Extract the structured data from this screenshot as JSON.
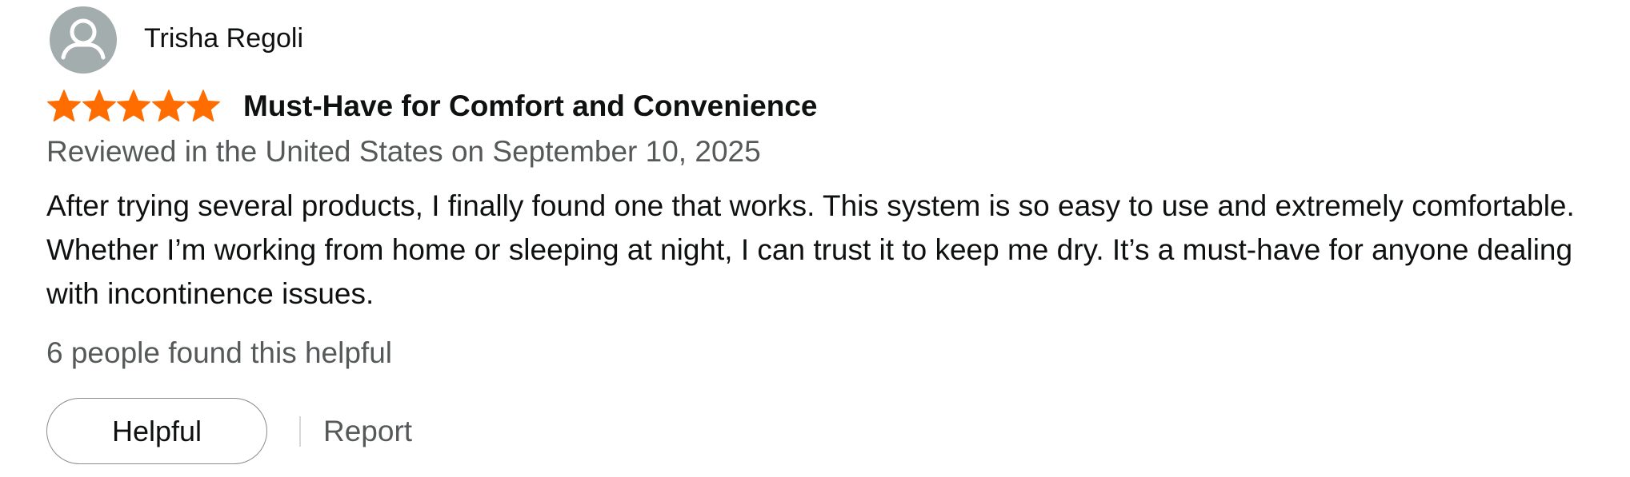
{
  "profile": {
    "name": "Trisha Regoli",
    "avatar_icon": "default-user-avatar-icon"
  },
  "rating": {
    "value": 5,
    "max": 5,
    "star_color": "#ff6d00"
  },
  "review": {
    "title": "Must-Have for Comfort and Convenience",
    "date": "Reviewed in the United States on September 10, 2025",
    "body": "After trying several products, I finally found one that works. This system is so easy to use and extremely comfortable. Whether I’m working from home or sleeping at night, I can trust it to keep me dry. It’s a must-have for anyone dealing with incontinence issues."
  },
  "helpful": {
    "count_text": "6 people found this helpful",
    "button_label": "Helpful",
    "report_label": "Report"
  }
}
